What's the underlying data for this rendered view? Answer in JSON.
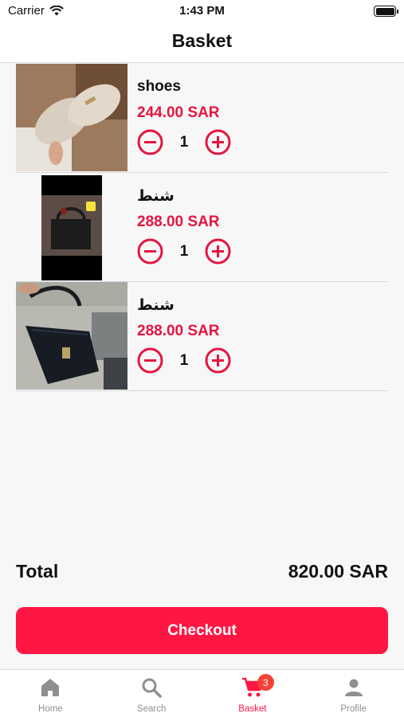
{
  "status_bar": {
    "carrier": "Carrier",
    "time": "1:43 PM"
  },
  "header": {
    "title": "Basket"
  },
  "items": [
    {
      "name": "shoes",
      "price": "244.00 SAR",
      "quantity": "1"
    },
    {
      "name": "شنط",
      "price": "288.00 SAR",
      "quantity": "1"
    },
    {
      "name": "شنط",
      "price": "288.00 SAR",
      "quantity": "1"
    }
  ],
  "summary": {
    "total_label": "Total",
    "total_value": "820.00 SAR"
  },
  "checkout": {
    "label": "Checkout"
  },
  "tabs": [
    {
      "label": "Home",
      "icon": "home-icon"
    },
    {
      "label": "Search",
      "icon": "search-icon"
    },
    {
      "label": "Basket",
      "icon": "cart-icon",
      "badge": "3"
    },
    {
      "label": "Profile",
      "icon": "profile-icon"
    }
  ],
  "colors": {
    "accent": "#ff1744",
    "price": "#e5153f",
    "inactive_tab": "#8e8e93",
    "badge": "#f44336"
  }
}
